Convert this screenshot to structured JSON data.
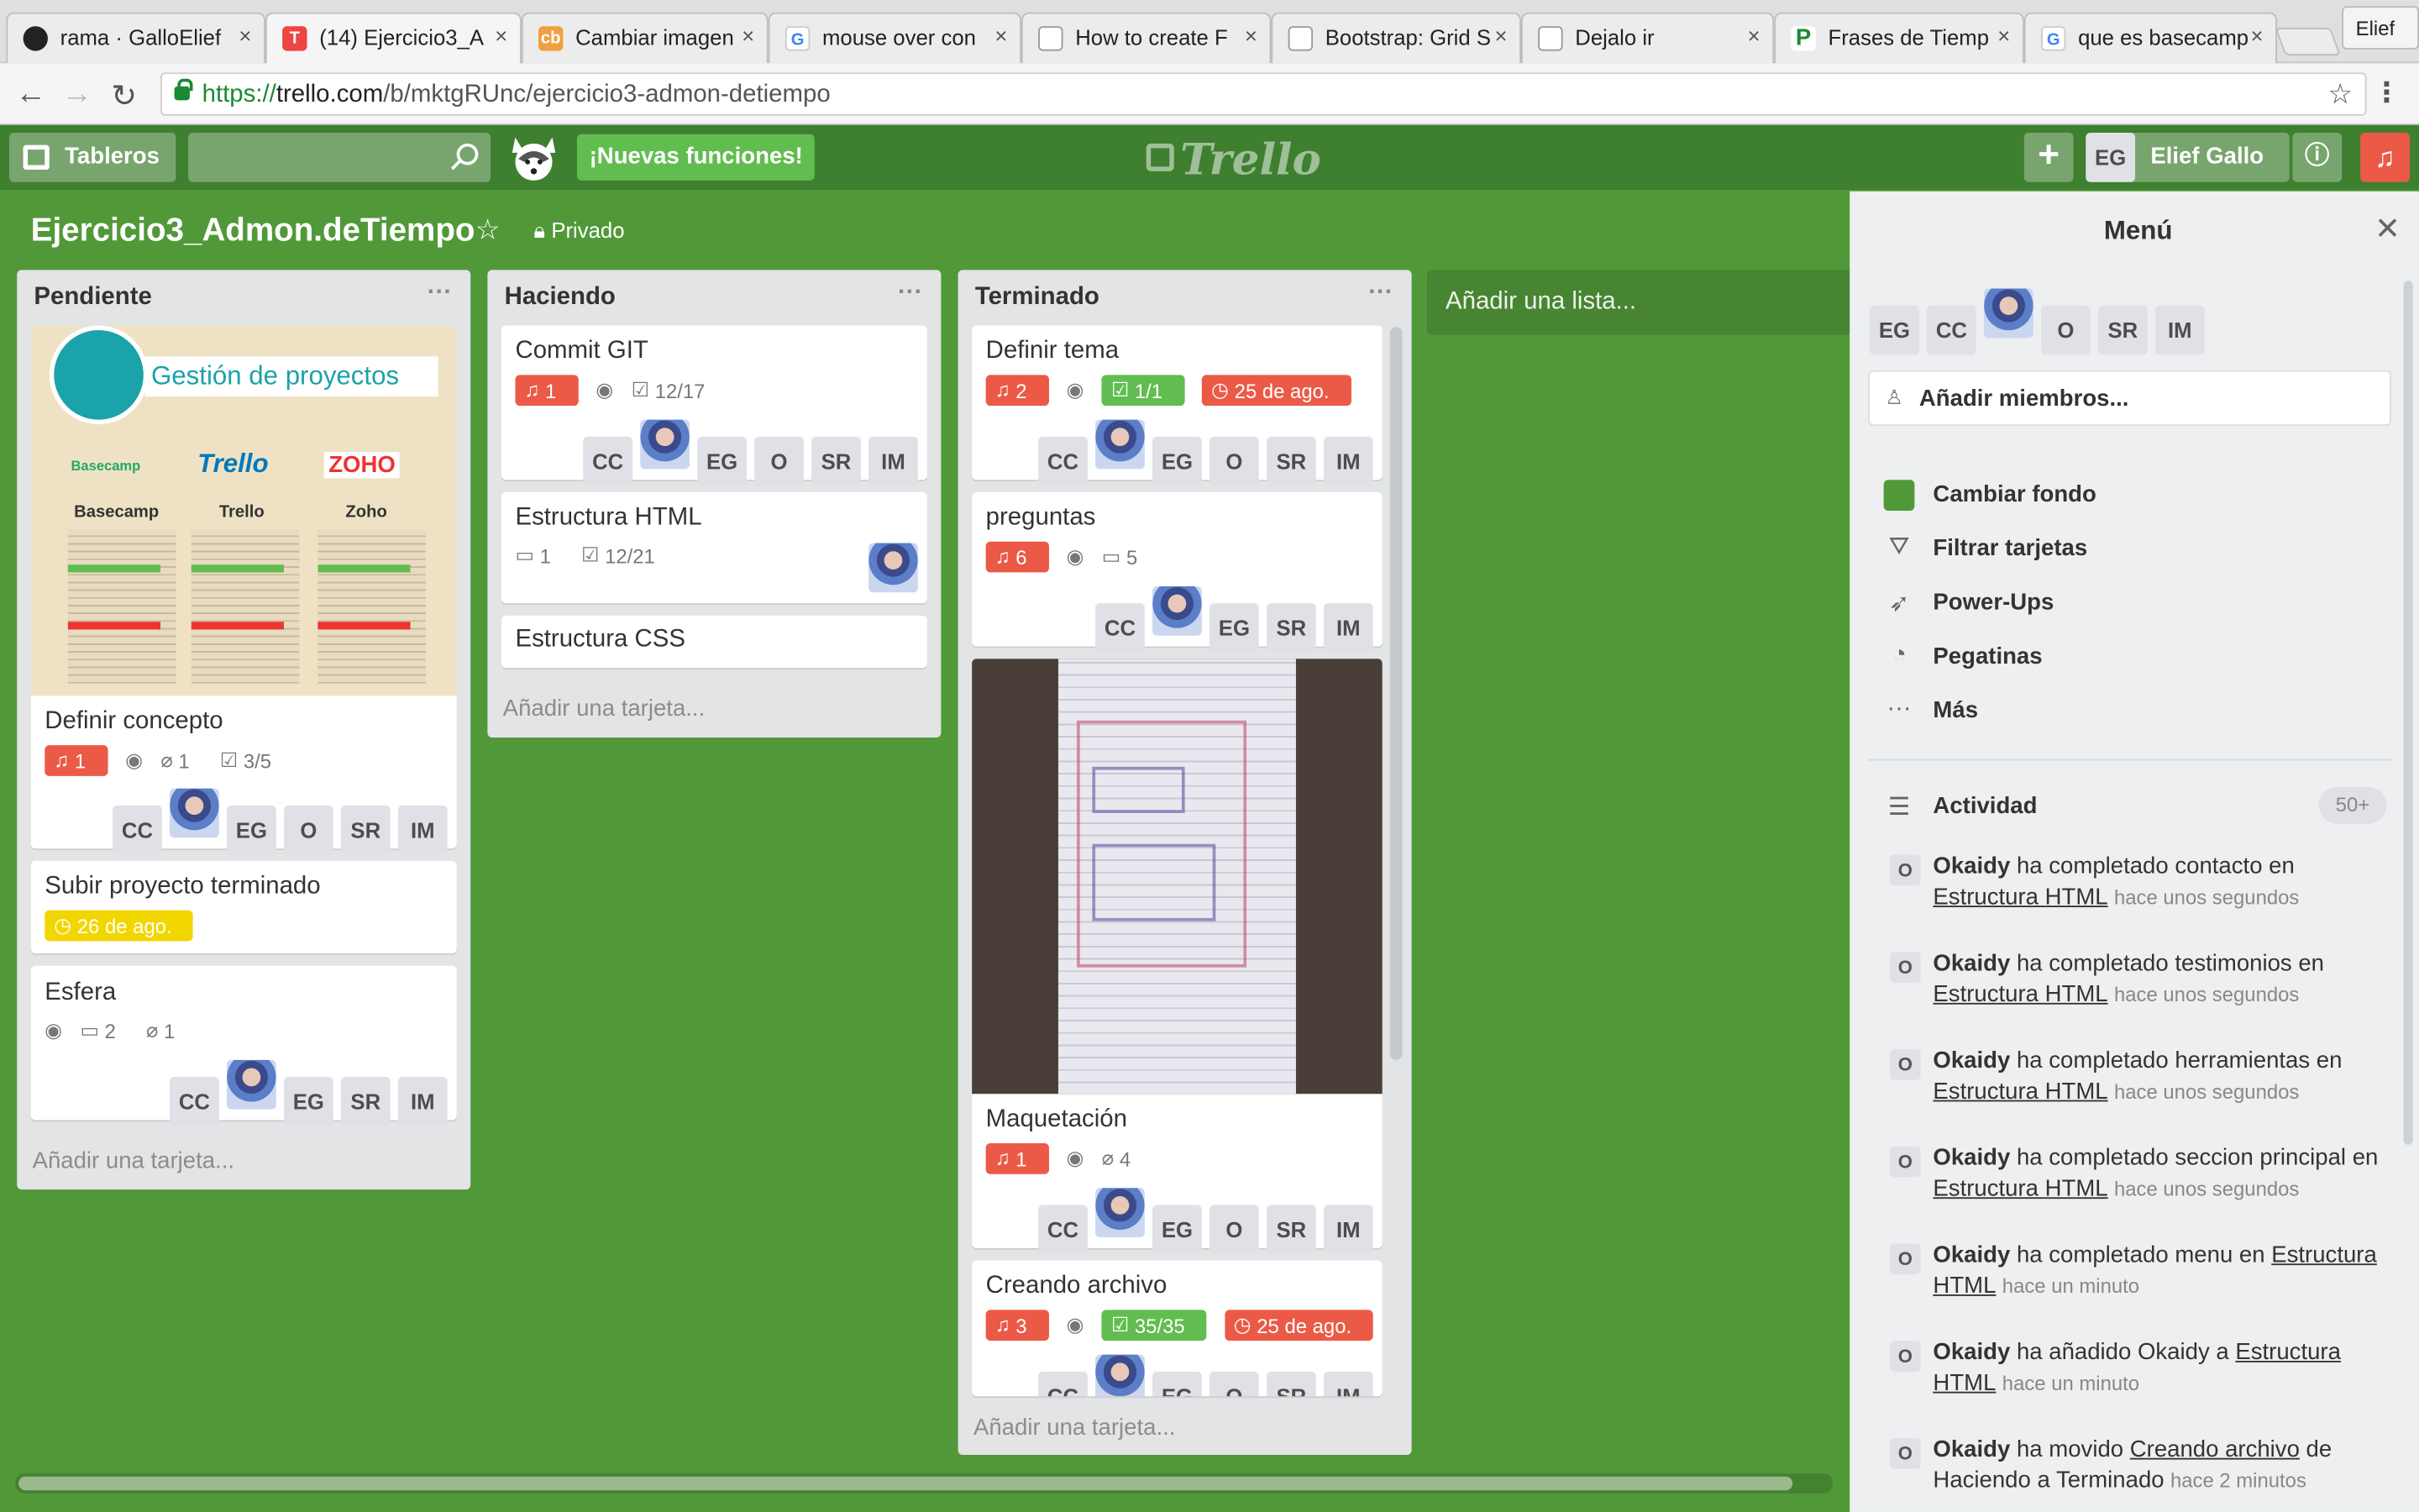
{
  "browser": {
    "tabs": [
      {
        "label": "rama · GalloElief",
        "icon": "github-icon"
      },
      {
        "label": "(14) Ejercicio3_A",
        "icon": "trello-icon"
      },
      {
        "label": "Cambiar imagen",
        "icon": "cb-icon"
      },
      {
        "label": "mouse over con",
        "icon": "google-icon"
      },
      {
        "label": "How to create F",
        "icon": "page-icon"
      },
      {
        "label": "Bootstrap: Grid S",
        "icon": "page-icon"
      },
      {
        "label": "Dejalo ir",
        "icon": "page-icon"
      },
      {
        "label": "Frases de Tiemp",
        "icon": "p-icon"
      },
      {
        "label": "que es basecamp",
        "icon": "google-icon"
      }
    ],
    "profile": "Elief",
    "url_scheme": "https://",
    "url_host": "trello.com",
    "url_path": "/b/mktgRUnc/ejercicio3-admon-detiempo"
  },
  "header": {
    "boards": "Tableros",
    "new_features": "¡Nuevas funciones!",
    "logo": "Trello",
    "user_initials": "EG",
    "user_name": "Elief Gallo"
  },
  "board": {
    "title": "Ejercicio3_Admon.deTiempo",
    "visibility": "Privado"
  },
  "lists": [
    {
      "name": "Pendiente",
      "add_card": "Añadir una tarjeta...",
      "cards": [
        {
          "title": "Definir concepto",
          "notif": "1",
          "attach": "1",
          "check": "3/5",
          "members": [
            "CC",
            "photo",
            "EG",
            "O",
            "SR",
            "IM"
          ],
          "cover": {
            "heading": "Gestión de proyectos",
            "col1": "Basecamp",
            "col2": "Trello",
            "col3": "Zoho",
            "logo1": "Basecamp",
            "logo2": "Trello",
            "logo3": "ZOHO"
          }
        },
        {
          "title": "Subir proyecto terminado",
          "due": "26 de ago."
        },
        {
          "title": "Esfera",
          "comments": "2",
          "attach": "1",
          "members": [
            "CC",
            "photo",
            "EG",
            "SR",
            "IM"
          ]
        }
      ]
    },
    {
      "name": "Haciendo",
      "add_card": "Añadir una tarjeta...",
      "cards": [
        {
          "title": "Commit GIT",
          "notif": "1",
          "check": "12/17",
          "members": [
            "CC",
            "photo",
            "EG",
            "O",
            "SR",
            "IM"
          ]
        },
        {
          "title": "Estructura HTML",
          "comments": "1",
          "check": "12/21",
          "members": [
            "photo"
          ]
        },
        {
          "title": "Estructura CSS"
        }
      ]
    },
    {
      "name": "Terminado",
      "add_card": "Añadir una tarjeta...",
      "cards": [
        {
          "title": "Definir tema",
          "notif": "2",
          "check": "1/1",
          "due": "25 de ago.",
          "members": [
            "CC",
            "photo",
            "EG",
            "O",
            "SR",
            "IM"
          ]
        },
        {
          "title": "preguntas",
          "notif": "6",
          "comments": "5",
          "members": [
            "CC",
            "photo",
            "EG",
            "SR",
            "IM"
          ]
        },
        {
          "title": "Maquetación",
          "notif": "1",
          "attach": "4",
          "members": [
            "CC",
            "photo",
            "EG",
            "O",
            "SR",
            "IM"
          ]
        },
        {
          "title": "Creando archivo",
          "notif": "3",
          "check": "35/35",
          "due": "25 de ago.",
          "members": [
            "CC",
            "photo",
            "EG",
            "O",
            "SR",
            "IM"
          ]
        }
      ]
    }
  ],
  "add_list": "Añadir una lista...",
  "menu": {
    "title": "Menú",
    "members": [
      "EG",
      "CC",
      "photo",
      "O",
      "SR",
      "IM"
    ],
    "add_members": "Añadir miembros...",
    "items": [
      "Cambiar fondo",
      "Filtrar tarjetas",
      "Power-Ups",
      "Pegatinas",
      "Más"
    ],
    "activity_label": "Actividad",
    "activity_count": "50+",
    "activity": [
      {
        "user": "Okaidy",
        "text": " ha completado contacto en ",
        "link": "Estructura HTML",
        "time": "hace unos segundos"
      },
      {
        "user": "Okaidy",
        "text": " ha completado testimonios en ",
        "link": "Estructura HTML",
        "time": "hace unos segundos"
      },
      {
        "user": "Okaidy",
        "text": " ha completado herramientas en ",
        "link": "Estructura HTML",
        "time": "hace unos segundos"
      },
      {
        "user": "Okaidy",
        "text": " ha completado seccion principal en ",
        "link": "Estructura HTML",
        "time": "hace unos segundos"
      },
      {
        "user": "Okaidy",
        "text": " ha completado menu en ",
        "link": "Estructura HTML",
        "time": "hace un minuto"
      },
      {
        "user": "Okaidy",
        "text": " ha añadido Okaidy a ",
        "link": "Estructura HTML",
        "time": "hace un minuto"
      },
      {
        "user": "Okaidy",
        "text": " ha movido ",
        "link": "Creando archivo",
        "text2": " de Haciendo a Terminado",
        "time": "hace 2 minutos"
      }
    ]
  },
  "colors": {
    "board_bg": "#519839",
    "header_bg": "#3e7f30",
    "red": "#eb5a46",
    "green": "#61bd4f",
    "yellow": "#f2d600"
  }
}
